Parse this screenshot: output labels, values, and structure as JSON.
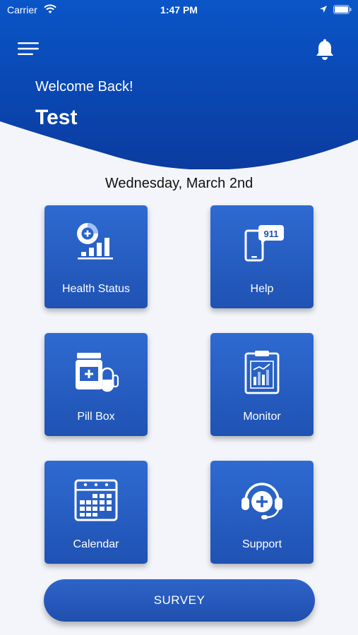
{
  "status_bar": {
    "carrier": "Carrier",
    "time": "1:47 PM"
  },
  "header": {
    "welcome": "Welcome Back!",
    "username": "Test"
  },
  "date": "Wednesday, March 2nd",
  "tiles": [
    {
      "label": "Health Status",
      "icon": "health-status-icon"
    },
    {
      "label": "Help",
      "icon": "phone-911-icon"
    },
    {
      "label": "Pill Box",
      "icon": "pill-bottle-icon"
    },
    {
      "label": "Monitor",
      "icon": "clipboard-chart-icon"
    },
    {
      "label": "Calendar",
      "icon": "calendar-icon"
    },
    {
      "label": "Support",
      "icon": "headset-icon"
    }
  ],
  "survey_button": "SURVEY",
  "colors": {
    "primary": "#1f52b3",
    "header_dark": "#0b3fa8",
    "background": "#f3f5fa"
  }
}
